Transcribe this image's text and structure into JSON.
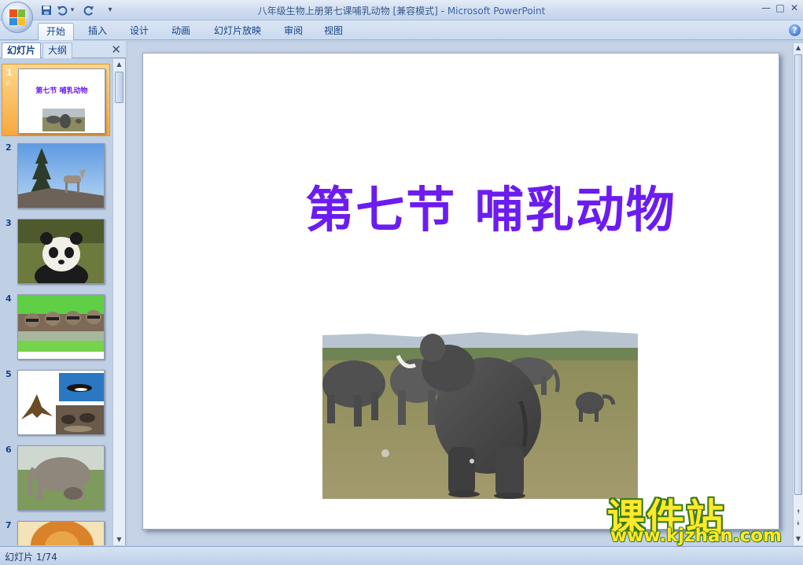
{
  "window": {
    "title": "八年级生物上册第七课哺乳动物 [兼容模式]",
    "app_name": "Microsoft PowerPoint",
    "separator": " - ",
    "minimize": "—",
    "maximize": "□",
    "close": "✕"
  },
  "quick_access": {
    "save_icon": "save-icon",
    "undo_icon": "undo-icon",
    "redo_icon": "redo-icon",
    "customize": "▾"
  },
  "ribbon": {
    "tabs": [
      {
        "label": "开始",
        "active": true
      },
      {
        "label": "插入"
      },
      {
        "label": "设计"
      },
      {
        "label": "动画"
      },
      {
        "label": "幻灯片放映"
      },
      {
        "label": "审阅"
      },
      {
        "label": "视图"
      }
    ],
    "help": "?"
  },
  "left_pane": {
    "tabs": [
      {
        "label": "幻灯片",
        "active": true
      },
      {
        "label": "大纲"
      }
    ],
    "close": "✕",
    "thumbnails": [
      {
        "number": "1",
        "title": "第七节 哺乳动物",
        "selected": true,
        "star": "☆"
      },
      {
        "number": "2"
      },
      {
        "number": "3"
      },
      {
        "number": "4"
      },
      {
        "number": "5"
      },
      {
        "number": "6"
      },
      {
        "number": "7"
      }
    ]
  },
  "slide": {
    "title": "第七节 哺乳动物",
    "title_color": "#6c1cf0"
  },
  "watermark": {
    "name": "课件站",
    "url": "www.kjzhan.com"
  },
  "status": {
    "slide_position": "幻灯片 1/74"
  },
  "colors": {
    "frame": "#bfcfe4",
    "selection": "#f7a83e",
    "accent": "#15428b"
  }
}
